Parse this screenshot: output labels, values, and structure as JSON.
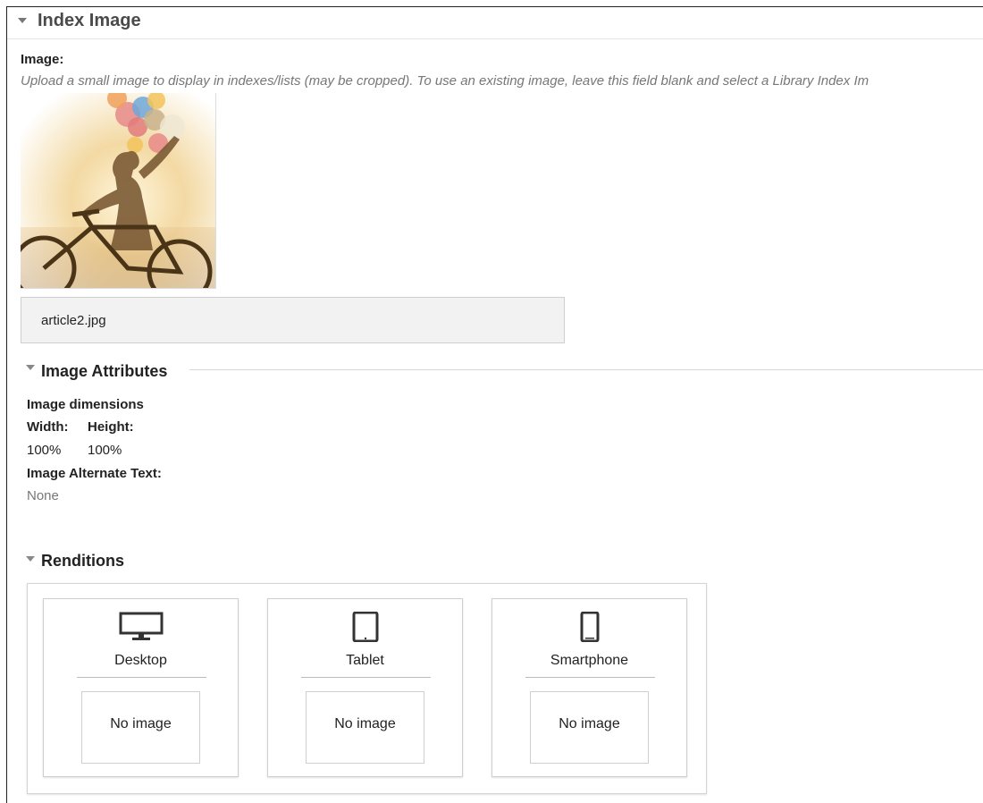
{
  "index_image": {
    "title": "Index Image",
    "field_label": "Image:",
    "help_text": "Upload a small image to display in indexes/lists (may be cropped). To use an existing image, leave this field blank and select a Library Index Im",
    "filename": "article2.jpg"
  },
  "image_attributes": {
    "title": "Image Attributes",
    "dimensions_label": "Image dimensions",
    "width_label": "Width:",
    "height_label": "Height:",
    "width_value": "100%",
    "height_value": "100%",
    "alt_label": "Image Alternate Text:",
    "alt_value": "None"
  },
  "renditions": {
    "title": "Renditions",
    "items": [
      {
        "label": "Desktop",
        "icon": "desktop-icon",
        "status": "No image"
      },
      {
        "label": "Tablet",
        "icon": "tablet-icon",
        "status": "No image"
      },
      {
        "label": "Smartphone",
        "icon": "smartphone-icon",
        "status": "No image"
      }
    ]
  }
}
